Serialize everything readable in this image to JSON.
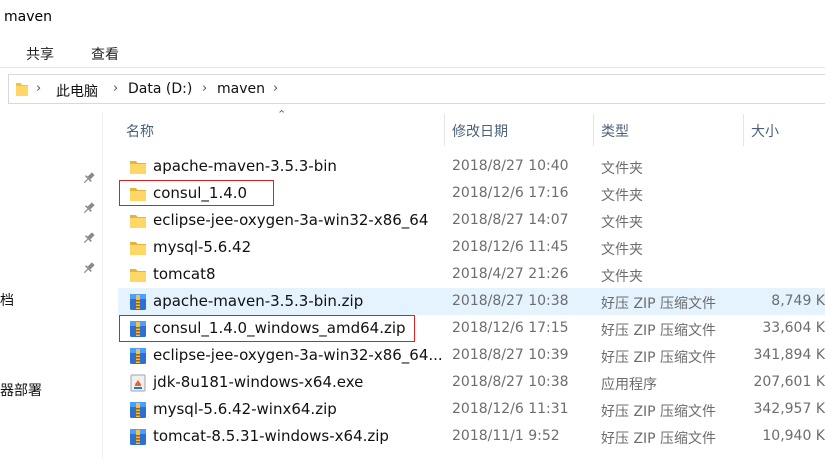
{
  "window": {
    "title": "maven"
  },
  "ribbon": {
    "tabs": [
      "共享",
      "查看"
    ]
  },
  "address": {
    "crumbs": [
      "此电脑",
      "Data (D:)",
      "maven"
    ]
  },
  "nav_pane": {
    "items": [
      "档",
      "器部署"
    ]
  },
  "columns": {
    "name": "名称",
    "date": "修改日期",
    "type": "类型",
    "size": "大小"
  },
  "files": [
    {
      "name": "apache-maven-3.5.3-bin",
      "date": "2018/8/27 10:40",
      "type": "文件夹",
      "size": "",
      "icon": "folder-icon"
    },
    {
      "name": "consul_1.4.0",
      "date": "2018/12/6 17:16",
      "type": "文件夹",
      "size": "",
      "icon": "folder-icon"
    },
    {
      "name": "eclipse-jee-oxygen-3a-win32-x86_64",
      "date": "2018/8/27 14:07",
      "type": "文件夹",
      "size": "",
      "icon": "folder-icon"
    },
    {
      "name": "mysql-5.6.42",
      "date": "2018/12/6 11:45",
      "type": "文件夹",
      "size": "",
      "icon": "folder-icon"
    },
    {
      "name": "tomcat8",
      "date": "2018/4/27 21:26",
      "type": "文件夹",
      "size": "",
      "icon": "folder-icon"
    },
    {
      "name": "apache-maven-3.5.3-bin.zip",
      "date": "2018/8/27 10:38",
      "type": "好压 ZIP 压缩文件",
      "size": "8,749 K",
      "icon": "zip-archive-icon"
    },
    {
      "name": "consul_1.4.0_windows_amd64.zip",
      "date": "2018/12/6 17:15",
      "type": "好压 ZIP 压缩文件",
      "size": "33,604 K",
      "icon": "zip-archive-icon"
    },
    {
      "name": "eclipse-jee-oxygen-3a-win32-x86_64...",
      "date": "2018/8/27 10:39",
      "type": "好压 ZIP 压缩文件",
      "size": "341,894 K",
      "icon": "zip-archive-icon"
    },
    {
      "name": "jdk-8u181-windows-x64.exe",
      "date": "2018/8/27 10:38",
      "type": "应用程序",
      "size": "207,601 K",
      "icon": "installer-icon"
    },
    {
      "name": "mysql-5.6.42-winx64.zip",
      "date": "2018/12/6 11:31",
      "type": "好压 ZIP 压缩文件",
      "size": "342,957 K",
      "icon": "zip-archive-icon"
    },
    {
      "name": "tomcat-8.5.31-windows-x64.zip",
      "date": "2018/11/1 9:52",
      "type": "好压 ZIP 压缩文件",
      "size": "10,940 K",
      "icon": "zip-archive-icon"
    }
  ],
  "highlight_color": "#e5f3ff",
  "annotation_color": "#e02020"
}
